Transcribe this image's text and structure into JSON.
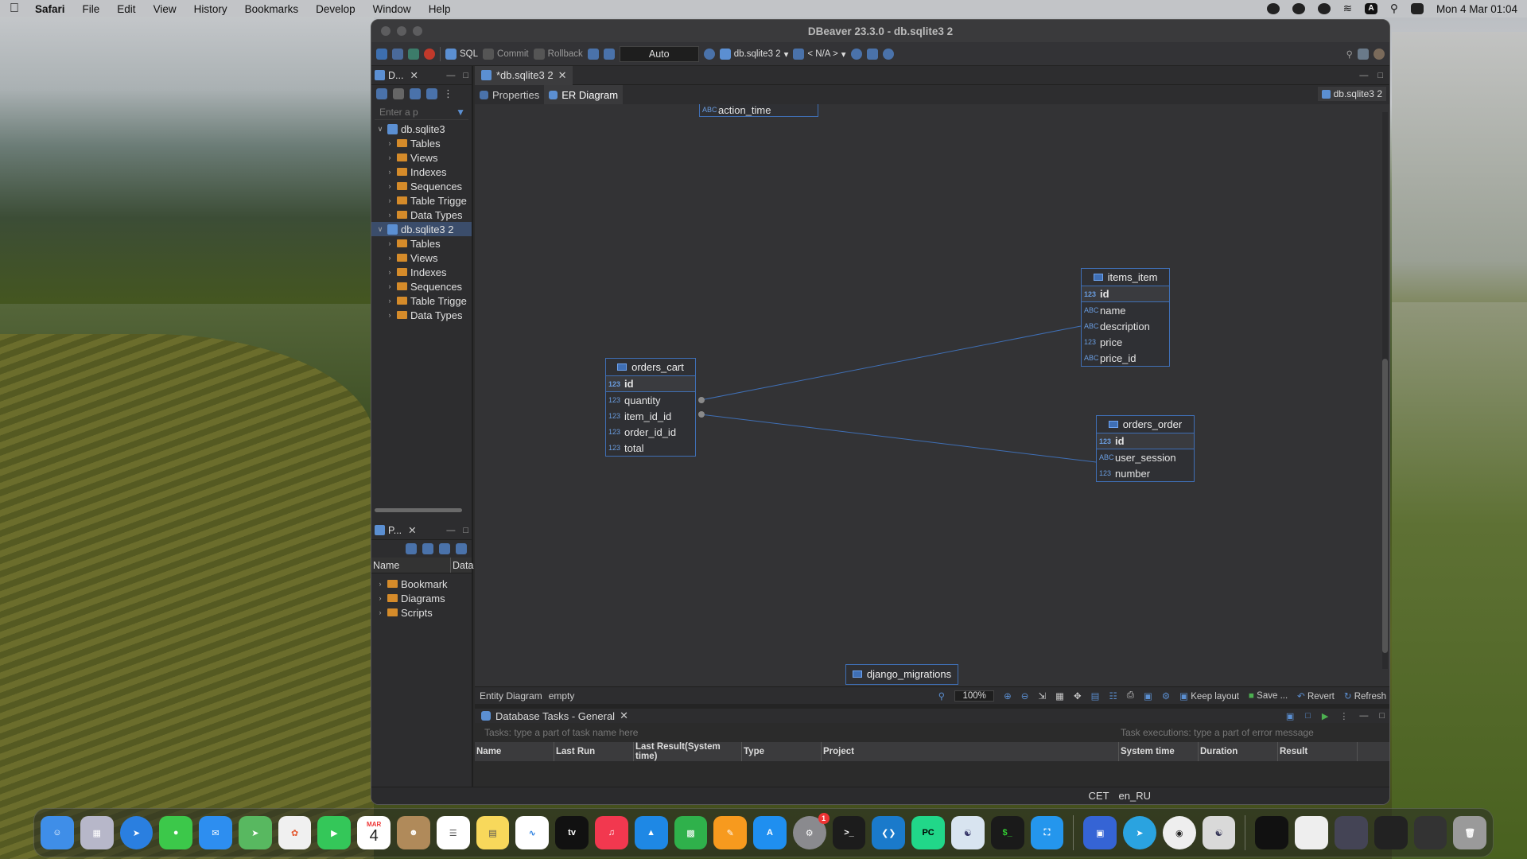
{
  "menubar": {
    "app": "Safari",
    "items": [
      "File",
      "Edit",
      "View",
      "History",
      "Bookmarks",
      "Develop",
      "Window",
      "Help"
    ],
    "clock": "Mon 4 Mar  01:04",
    "input_source": "A"
  },
  "window": {
    "title": "DBeaver 23.3.0 - db.sqlite3 2"
  },
  "toolbar": {
    "sql": "SQL",
    "commit": "Commit",
    "rollback": "Rollback",
    "auto": "Auto",
    "datasource": "db.sqlite3 2",
    "schema": "< N/A >"
  },
  "navigator": {
    "tab": "D...",
    "filter_placeholder": "Enter a p",
    "tree": [
      {
        "label": "db.sqlite3",
        "type": "db",
        "level": 0,
        "expanded": true
      },
      {
        "label": "Tables",
        "type": "folder",
        "level": 1
      },
      {
        "label": "Views",
        "type": "folder",
        "level": 1
      },
      {
        "label": "Indexes",
        "type": "folder",
        "level": 1
      },
      {
        "label": "Sequences",
        "type": "folder",
        "level": 1
      },
      {
        "label": "Table Trigge",
        "type": "folder",
        "level": 1
      },
      {
        "label": "Data Types",
        "type": "folder",
        "level": 1
      },
      {
        "label": "db.sqlite3 2",
        "type": "db",
        "level": 0,
        "expanded": true,
        "selected": true
      },
      {
        "label": "Tables",
        "type": "folder",
        "level": 1
      },
      {
        "label": "Views",
        "type": "folder",
        "level": 1
      },
      {
        "label": "Indexes",
        "type": "folder",
        "level": 1
      },
      {
        "label": "Sequences",
        "type": "folder",
        "level": 1
      },
      {
        "label": "Table Trigge",
        "type": "folder",
        "level": 1
      },
      {
        "label": "Data Types",
        "type": "folder",
        "level": 1
      }
    ]
  },
  "projects": {
    "tab": "P...",
    "col_name": "Name",
    "col_data": "Data",
    "items": [
      "Bookmark",
      "Diagrams",
      "Scripts"
    ]
  },
  "editor": {
    "tab": "*db.sqlite3 2",
    "subtab_properties": "Properties",
    "subtab_er": "ER Diagram",
    "db_chip": "db.sqlite3 2"
  },
  "diagram": {
    "entities": [
      {
        "name": "orders_cart",
        "pk": "id",
        "cols": [
          [
            "123",
            "quantity"
          ],
          [
            "123",
            "item_id_id"
          ],
          [
            "123",
            "order_id_id"
          ],
          [
            "123",
            "total"
          ]
        ]
      },
      {
        "name": "items_item",
        "pk": "id",
        "cols": [
          [
            "ABC",
            "name"
          ],
          [
            "ABC",
            "description"
          ],
          [
            "123",
            "price"
          ],
          [
            "ABC",
            "price_id"
          ]
        ]
      },
      {
        "name": "orders_order",
        "pk": "id",
        "cols": [
          [
            "ABC",
            "user_session"
          ],
          [
            "123",
            "number"
          ]
        ]
      }
    ],
    "top_partial": "action_time",
    "bottom_partial": "django_migrations",
    "status_label": "Entity Diagram",
    "status_value": "empty",
    "zoom": "100%",
    "keep_layout": "Keep layout",
    "save": "Save ...",
    "revert": "Revert",
    "refresh": "Refresh"
  },
  "tasks": {
    "tab": "Database Tasks - General",
    "filter_tasks": "Tasks: type a part of task name here",
    "filter_exec": "Task executions: type a part of error message",
    "cols_left": [
      "Name",
      "Last Run",
      "Last Result(System time)",
      "Type",
      "Project"
    ],
    "cols_right": [
      "System time",
      "Duration",
      "Result"
    ]
  },
  "statusbar": {
    "tz": "CET",
    "locale": "en_RU"
  },
  "dock": {
    "calendar_month": "MAR",
    "calendar_day": "4",
    "badge": "1",
    "apps": [
      "finder",
      "launchpad",
      "safari",
      "messages",
      "mail",
      "maps",
      "photos",
      "facetime",
      "calendar",
      "contacts",
      "reminders",
      "notes",
      "freeform",
      "tv",
      "music",
      "keynote",
      "numbers",
      "pages",
      "app-store",
      "system-settings",
      "terminal",
      "vscode",
      "pycharm",
      "pgadmin",
      "iterm",
      "docker",
      "dbeaver",
      "telegram",
      "vpn",
      "postgres"
    ]
  }
}
